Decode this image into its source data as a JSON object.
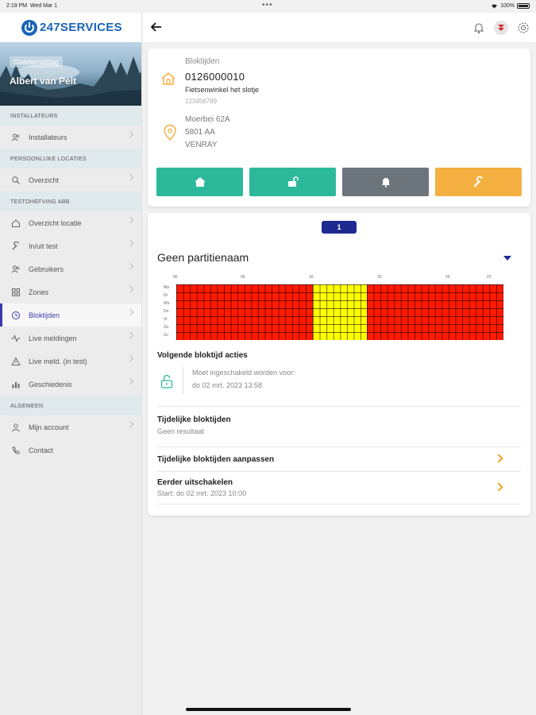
{
  "status": {
    "time": "2:19 PM",
    "date": "Wed Mar 1",
    "battery": "100%"
  },
  "brand": {
    "name": "247SERVICES",
    "color": "#1a64b8"
  },
  "user": {
    "role": "Goedemiddag",
    "name": "Albert van Pelt"
  },
  "sidebar": {
    "sections": [
      {
        "title": "INSTALLATEURS",
        "items": [
          {
            "label": "Installateurs",
            "icon": "people-icon"
          }
        ]
      },
      {
        "title": "PERSOONLIJKE LOCATIES",
        "items": [
          {
            "label": "Overzicht",
            "icon": "search-icon"
          }
        ]
      },
      {
        "title": "TESTOHEFVING ABB",
        "items": [
          {
            "label": "Overzicht locatie",
            "icon": "home-icon"
          },
          {
            "label": "In/uit test",
            "icon": "wrench-icon"
          },
          {
            "label": "Gebruikers",
            "icon": "people-icon"
          },
          {
            "label": "Zones",
            "icon": "grid-icon"
          },
          {
            "label": "Bloktijden",
            "icon": "clock-icon",
            "active": true
          },
          {
            "label": "Live meldingen",
            "icon": "pulse-icon"
          },
          {
            "label": "Live meld. (in test)",
            "icon": "warning-icon"
          },
          {
            "label": "Geschiedenis",
            "icon": "bar-chart-icon"
          }
        ]
      },
      {
        "title": "ALGEMEEN",
        "items": [
          {
            "label": "Mijn account",
            "icon": "person-icon"
          },
          {
            "label": "Contact",
            "icon": "phone-icon"
          }
        ]
      }
    ]
  },
  "location": {
    "section_label": "Bloktijden",
    "code": "0126000010",
    "name": "Fietsenwinkel het slotje",
    "subcode": "123456789",
    "street": "Moerbei 62A",
    "postcode": "5801 AA",
    "city": "VENRAY"
  },
  "actions": [
    {
      "icon": "home-icon",
      "color": "#2bb99a"
    },
    {
      "icon": "unlock-icon",
      "color": "#2bb99a"
    },
    {
      "icon": "bell-icon",
      "color": "#6c757b"
    },
    {
      "icon": "wrench-icon",
      "color": "#f5b042"
    }
  ],
  "partition": {
    "number": "1",
    "name": "Geen partitienaam",
    "hour_labels": [
      "00",
      "05",
      "10",
      "15",
      "20",
      "23"
    ],
    "day_labels": [
      "Ma",
      "Di",
      "Wo",
      "Do",
      "Vr",
      "Za",
      "Zo"
    ],
    "schedule": {
      "unlocked_color": "#ffff00",
      "locked_color": "#ff1a00",
      "unlocked_from_fraction": 0.4167,
      "unlocked_to_fraction": 0.5833
    }
  },
  "next_action": {
    "title": "Volgende bloktijd acties",
    "line1": "Moet ingeschakeld worden voor:",
    "line2": "do 02 mrt. 2023 13:58"
  },
  "temp": {
    "title": "Tijdelijke bloktijden",
    "value": "Geen resultaat"
  },
  "rows": [
    {
      "title": "Tijdelijke bloktijden aanpassen",
      "subtitle": ""
    },
    {
      "title": "Eerder uitschakelen",
      "subtitle": "Start: do 02 mrt. 2023 10:00"
    }
  ]
}
